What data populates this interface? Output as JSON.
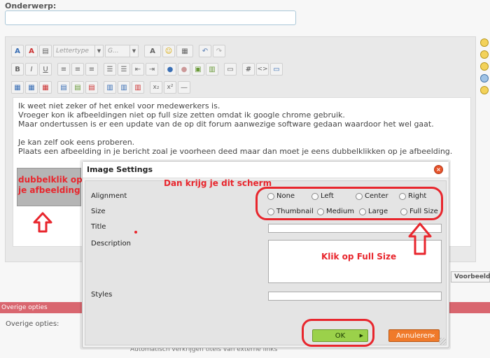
{
  "subject": {
    "label": "Onderwerp:",
    "value": ""
  },
  "toolbar": {
    "font_placeholder": "Lettertype",
    "size_placeholder": "G...",
    "icon_buttons": [
      "bold-icon",
      "italic-icon",
      "underline-icon",
      "align-left-icon",
      "align-center-icon",
      "align-right-icon",
      "numbered-list-icon",
      "bullet-list-icon",
      "outdent-icon",
      "indent-icon",
      "link-icon",
      "unlink-icon",
      "image-icon",
      "media-icon",
      "quote-icon",
      "hash-icon",
      "code-icon",
      "spoiler-icon"
    ],
    "bold_label": "B",
    "italic_label": "I",
    "underline_label": "U",
    "hash_label": "#",
    "code_label": "<>",
    "sub_label": "x₂",
    "sup_label": "x²",
    "text_color_label": "A"
  },
  "editor": {
    "lines": [
      "Ik weet niet zeker of het enkel voor medewerkers is.",
      "Vroeger kon ik afbeeldingen niet op full size zetten omdat ik google chrome gebruik.",
      "Maar ondertussen is er een update van de op dit forum aanwezige software gedaan waardoor het wel gaat.",
      "",
      "Je kan zelf ook eens proberen.",
      "Plaats een afbeelding in je bericht zoal je voorheen deed maar dan moet je eens dubbelklikken op je afbeelding."
    ]
  },
  "annotations": {
    "double_click_line1": "dubbelklik op",
    "double_click_line2": "je afbeelding",
    "screen_note": "Dan krijg je dit scherm",
    "full_size_note": "Klik op Full Size",
    "color": "#e8262d"
  },
  "dialog": {
    "title": "Image Settings",
    "alignment_label": "Alignment",
    "alignment_options": [
      "None",
      "Left",
      "Center",
      "Right"
    ],
    "size_label": "Size",
    "size_options": [
      "Thumbnail",
      "Medium",
      "Large",
      "Full Size"
    ],
    "title_label": "Title",
    "title_value": "",
    "description_label": "Description",
    "description_value": "",
    "styles_label": "Styles",
    "styles_value": "",
    "ok_label": "OK",
    "cancel_label": "Annuleren"
  },
  "page": {
    "preview_label": "Voorbeeld",
    "overige_bar": "Overige opties",
    "overige_label": "Overige opties:",
    "overige_footer": "Automatisch verkrijgen titels van externe links"
  }
}
